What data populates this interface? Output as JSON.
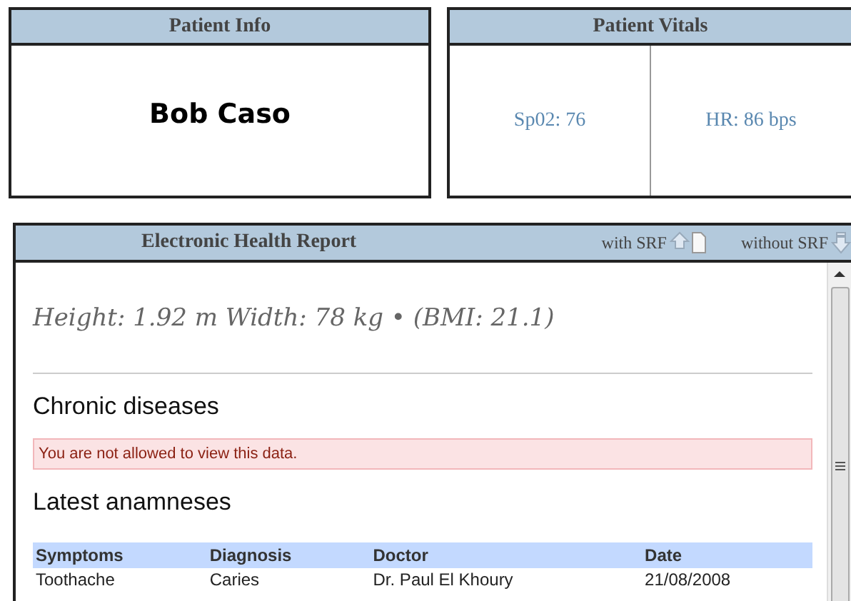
{
  "patient_info": {
    "title": "Patient Info",
    "name": "Bob Caso"
  },
  "patient_vitals": {
    "title": "Patient Vitals",
    "readings": [
      "Sp02: 76",
      "HR: 86 bps"
    ]
  },
  "report": {
    "title": "Electronic Health Report",
    "actions": [
      {
        "label": "with SRF",
        "kind": "upload"
      },
      {
        "label": "without SRF",
        "kind": "download"
      }
    ],
    "measurements": "Height: 1.92 m Width: 78 kg • (BMI: 21.1)",
    "sections": [
      {
        "heading": "Chronic diseases",
        "kind": "error",
        "message": "You are not allowed to view this data."
      },
      {
        "heading": "Latest anamneses",
        "kind": "table",
        "columns": [
          "Symptoms",
          "Diagnosis",
          "Doctor",
          "Date"
        ],
        "rows": [
          [
            "Toothache",
            "Caries",
            "Dr. Paul El Khoury",
            "21/08/2008"
          ]
        ]
      }
    ]
  }
}
